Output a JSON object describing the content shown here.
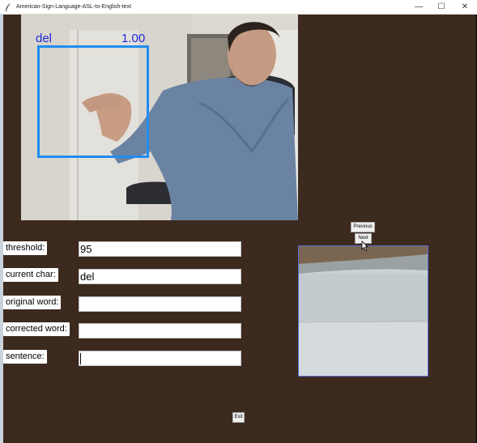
{
  "window": {
    "title": "American-Sign-Language-ASL-to-English-text",
    "icon": "feather-icon",
    "controls": {
      "minimize": "—",
      "maximize": "☐",
      "close": "✕"
    },
    "background": "#3c2a1f"
  },
  "video": {
    "prediction_label": "del",
    "prediction_confidence": "1.00",
    "overlay_color": "#1f8df0"
  },
  "form": {
    "threshold": {
      "label": "threshold:",
      "value": "95"
    },
    "current_char": {
      "label": "current char:",
      "value": "del"
    },
    "original_word": {
      "label": "original word:",
      "value": ""
    },
    "corrected_word": {
      "label": "corrected word:",
      "value": ""
    },
    "sentence": {
      "label": "sentence:",
      "value": ""
    }
  },
  "buttons": {
    "previous": "Previous",
    "next": "Next",
    "exit": "Exit"
  }
}
